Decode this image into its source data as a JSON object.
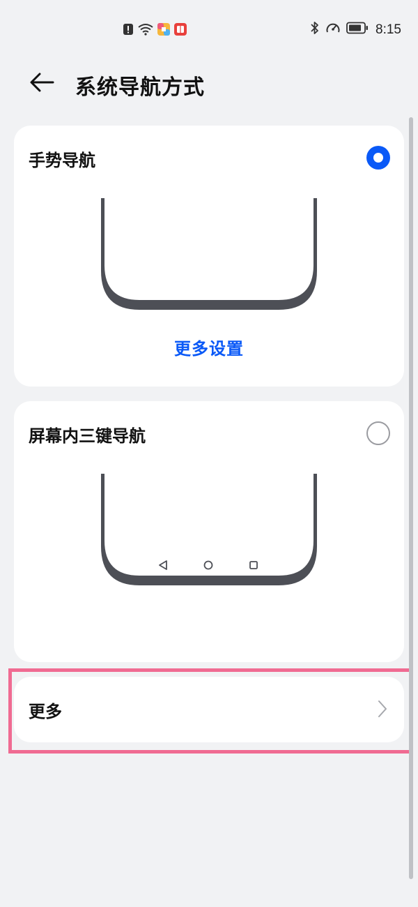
{
  "status_bar": {
    "time": "8:15",
    "left_icons": [
      "alert-icon",
      "wifi-icon",
      "app-icon-colorful",
      "app-icon-red"
    ],
    "right_icons": [
      "bluetooth-icon",
      "speed-icon",
      "battery-icon"
    ]
  },
  "header": {
    "title": "系统导航方式",
    "back_icon": "arrow-left-icon"
  },
  "options": {
    "gesture": {
      "label": "手势导航",
      "selected": true,
      "link": "更多设置"
    },
    "three_key": {
      "label": "屏幕内三键导航",
      "selected": false,
      "nav_icons": [
        "triangle-back-icon",
        "circle-home-icon",
        "square-recent-icon"
      ]
    }
  },
  "more": {
    "label": "更多",
    "icon": "chevron-right-icon"
  },
  "colors": {
    "accent": "#0a59f7",
    "background": "#f1f2f4",
    "card": "#ffffff",
    "phone_outline": "#4d4f56",
    "highlight": "#f06b92"
  }
}
